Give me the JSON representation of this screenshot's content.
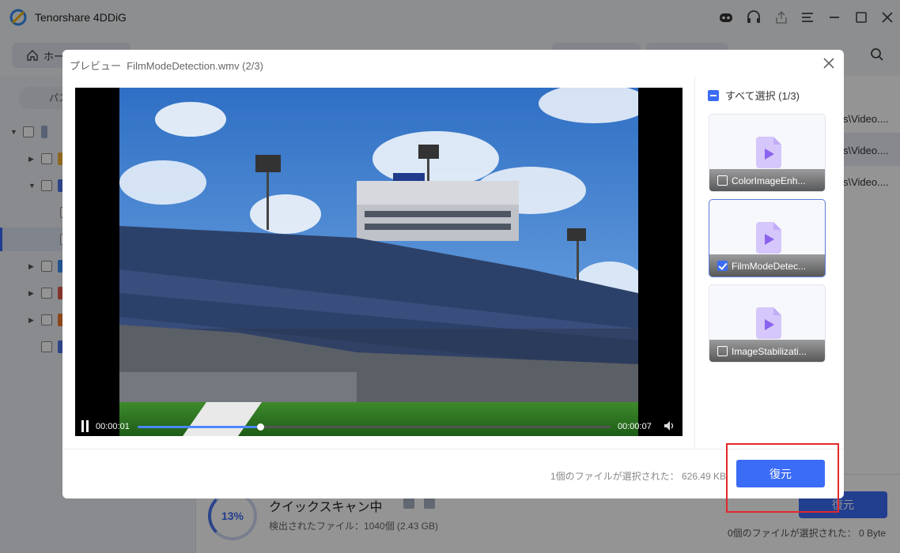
{
  "app": {
    "title": "Tenorshare 4DDiG",
    "home_tab": "ホーム",
    "sidebar_tab": "パス",
    "path_rows": [
      "s\\Video....",
      "s\\Video....",
      "s\\Video...."
    ]
  },
  "scan": {
    "percent": "13%",
    "progress": 0.13,
    "title": "クイックスキャン中",
    "found": "検出されたファイル：1040個 (2.43 GB)",
    "recover_label": "復元",
    "selected_info": "0個のファイルが選択された：  0 Byte"
  },
  "preview": {
    "label": "プレビュー",
    "filename": "FilmModeDetection.wmv (2/3)",
    "select_all": "すべて選択 (1/3)",
    "current_time": "00:00:01",
    "total_time": "00:00:07",
    "progress": 0.26,
    "files": [
      {
        "name": "ColorImageEnh...",
        "checked": false
      },
      {
        "name": "FilmModeDetec...",
        "checked": true
      },
      {
        "name": "ImageStabilizati...",
        "checked": false
      }
    ],
    "selected_info": "1個のファイルが選択された：  626.49 KB",
    "recover_label": "復元"
  },
  "colors": {
    "accent": "#3b6cf6",
    "highlight": "#e3272c",
    "file_icon": "#b69af7"
  },
  "icons": [
    "app-logo-icon",
    "robot-icon",
    "headset-icon",
    "share-icon",
    "menu-icon",
    "minimize-icon",
    "maximize-icon",
    "window-close-icon",
    "home-icon",
    "search-icon",
    "close-icon",
    "pause-icon",
    "volume-icon",
    "video-file-icon"
  ]
}
